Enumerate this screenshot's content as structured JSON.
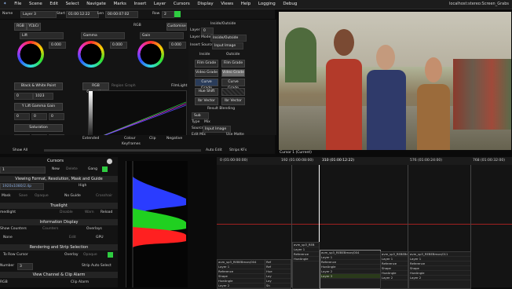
{
  "menubar": {
    "items": [
      "File",
      "Scene",
      "Edit",
      "Select",
      "Navigate",
      "Marks",
      "Insert",
      "Layer",
      "Cursors",
      "Display",
      "Views",
      "Help",
      "Logging",
      "Debug"
    ],
    "right_text": "localhost:stereo:Screen_Grabs"
  },
  "layer_bar": {
    "name_label": "Name",
    "name_value": "Layer 3",
    "start_label": "Start",
    "start_value": "01:00:12:22",
    "len_label": "Len",
    "len_value": "00:00:07:02",
    "row_label": "Row",
    "row_value": "2"
  },
  "color_panel": {
    "mode_tabs": [
      "RGB",
      "YCbCr"
    ],
    "wheels": [
      {
        "title": "Lift",
        "value": "0.000"
      },
      {
        "title": "Gamma",
        "value": "0.000"
      },
      {
        "title": "Gain",
        "value": "0.000"
      }
    ],
    "rgb_label": "RGB",
    "customise_label": "Customise",
    "black_white": "Black & White Point",
    "gain_field": "1023",
    "field_zero": "0",
    "lift_gain_label": "Y Lift Gamma Gain",
    "saturation_label": "Saturation",
    "sat_value": "1.00",
    "rgb_correction": "RGB Correction",
    "region_graph": "Region Graph",
    "filmlight": "FilmLight",
    "graph_ticks": [
      "0",
      "256",
      "512",
      "768"
    ],
    "extended": "Extended",
    "colour_lbl": "Colour",
    "clip_lbl": "Clip",
    "negative_lbl": "Negative",
    "keyframes": "Keyframes",
    "show_all": "Show All",
    "auto_edit": "Auto Edit",
    "strip_kf": "Strips KFs"
  },
  "layer_mode_panel": {
    "inside_outside": "Inside/Outside",
    "layer_label": "Layer",
    "layer_val": "0",
    "layer_mode": "Layer Mode",
    "layer_mode_val": "Inside/Outside",
    "insert_source": "Insert Source",
    "insert_source_val": "Input Image",
    "inside": "Inside",
    "outside": "Outside",
    "buttons_left": [
      "Film Grade",
      "Video Grade",
      "Curve Grade",
      "Hue Shift",
      "Ibr Vector"
    ],
    "buttons_right": [
      "Film Grade",
      "Video Grade",
      "Curve Grade",
      "",
      "Ibr Vector"
    ],
    "result_blending": "Result Blending",
    "blend_val": "Sub",
    "type_label": "Type",
    "mix_label": "Mix",
    "source_label": "Source",
    "source_val": "Input Image",
    "edit_mix": "Edit Mix",
    "use_matte": "Use Matte"
  },
  "viewer": {
    "caption": "Cursor 1 (Current)"
  },
  "cursors_panel": {
    "title": "Cursors",
    "cursor_val": "1",
    "new": "New",
    "delete": "Delete",
    "gang": "Gang",
    "viewing_format": "Viewing Format, Resolution, Mask and Guide",
    "format_val": "1920x1080/2.4p",
    "high": "High",
    "mask": "Mask",
    "save": "Save",
    "opaque": "Opaque",
    "no_guide": "No Guide",
    "crosshair": "Crosshair",
    "truelight": "Truelight",
    "truelight_val": "medlight",
    "disable": "Disable",
    "warn": "Warn",
    "reload": "Reload",
    "info_display": "Information Display",
    "show_counters": "Show Counters",
    "counters": "Counters",
    "overlays": "Overlays",
    "none": "None",
    "edit": "Edit",
    "gpu": "GPU",
    "rendering": "Rendering and Strip Selection",
    "to_row_cursor": "To Row Cursor",
    "overlay": "Overlay",
    "opaque2": "Opaque",
    "number": "Number",
    "number_val": "3",
    "strip_auto": "Strip Auto Select",
    "view_channel": "View Channel & Clip Alarm",
    "rgb": "RGB",
    "clip_alarm": "Clip Alarm"
  },
  "timeline": {
    "ticks": [
      "0 (01:00:00:00)",
      "192 (01:00:08:00)",
      "310 (01:00:12:22)",
      "576 (01:00:24:00)",
      "768 (01:00:32:00)"
    ],
    "clips": [
      {
        "rows": [
          "avm_sp3_REB",
          "Layer 1",
          "Reference",
          "HueAngle"
        ]
      },
      {
        "rows": [
          "avm_sp3_REBEBmon/004",
          "Layer 1",
          "Reference",
          "HueAngle",
          "Layer 2",
          "Layer 3"
        ]
      },
      {
        "rows": [
          "avm_sp3_REBEBmon/011",
          "Layer 1",
          "Reference",
          "Shape",
          "HueAngle",
          "Layer 2",
          "Layer 3"
        ]
      },
      {
        "rows": [
          "avm_sp3_REBEBmon/011",
          "Layer 1",
          "Reference",
          "Shape",
          "HueAngle",
          "Layer 2",
          "Layer 3"
        ]
      }
    ],
    "left_clip_rows": [
      "avm_sp3_REBEBmon/004",
      "Layer 1",
      "Reference",
      "Shape",
      "HueAngle",
      "Layer 2",
      "Layer 3",
      "Shape"
    ],
    "mid_labels": [
      "Ref",
      "Ref",
      "Hue",
      "Lay",
      "Lay",
      "Sh"
    ]
  },
  "colors": {
    "accent_green": "#2ecc40",
    "scope_blue": "#2a3cff",
    "scope_green": "#20d020",
    "scope_red": "#ff2020",
    "playhead": "#ffffff"
  }
}
